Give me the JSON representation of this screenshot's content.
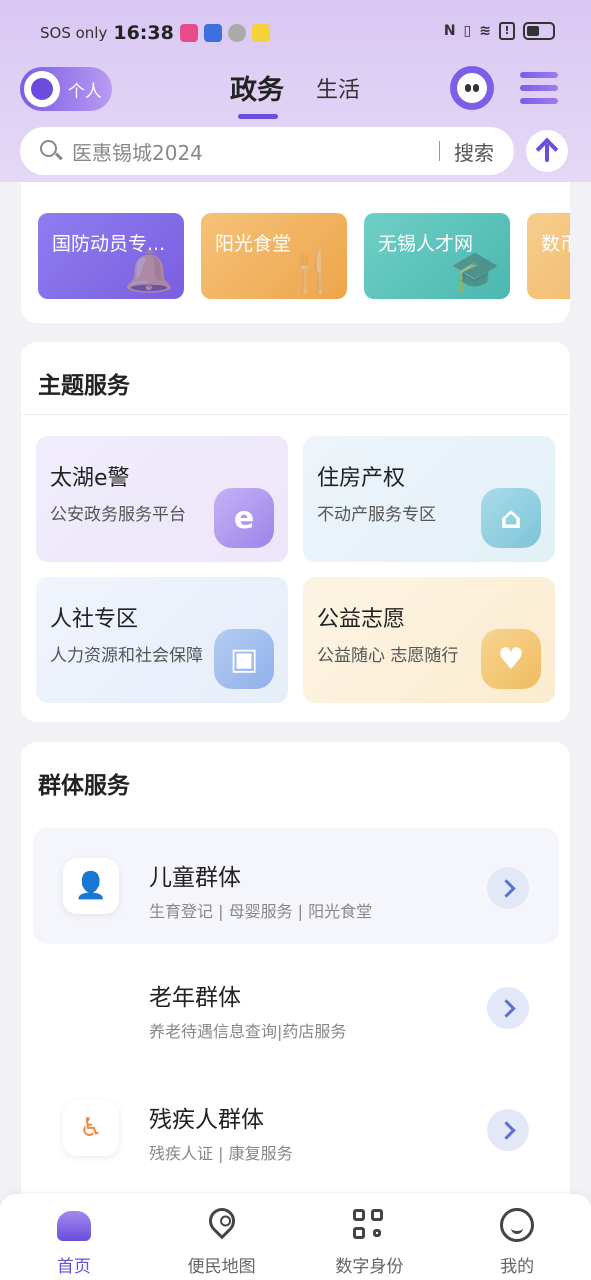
{
  "status_bar": {
    "carrier": "SOS only",
    "time": "16:38"
  },
  "header": {
    "personal_label": "个人",
    "tabs": [
      {
        "label": "政务",
        "active": true
      },
      {
        "label": "生活",
        "active": false
      }
    ],
    "accent_color": "#6a4ddc"
  },
  "search": {
    "placeholder": "医惠锡城2024",
    "button": "搜索"
  },
  "quick_links": [
    {
      "label": "国防动员专...",
      "color": "#8e74ea",
      "icon": "bell-icon"
    },
    {
      "label": "阳光食堂",
      "color": "#f0b460",
      "icon": "fork-knife-icon"
    },
    {
      "label": "无锡人才网",
      "color": "#5cc4bd",
      "icon": "graduation-cap-icon"
    },
    {
      "label": "数币",
      "color": "#f2c27c",
      "icon": "coin-icon"
    }
  ],
  "topic_services": {
    "title": "主题服务",
    "items": [
      {
        "title": "太湖e警",
        "subtitle": "公安政务服务平台",
        "icon": "police-shield-icon",
        "icon_glyph": "e"
      },
      {
        "title": "住房产权",
        "subtitle": "不动产服务专区",
        "icon": "house-icon",
        "icon_glyph": "⌂"
      },
      {
        "title": "人社专区",
        "subtitle": "人力资源和社会保障",
        "icon": "id-card-icon",
        "icon_glyph": "▣"
      },
      {
        "title": "公益志愿",
        "subtitle": "公益随心 志愿随行",
        "icon": "heart-hand-icon",
        "icon_glyph": "♥"
      }
    ]
  },
  "group_services": {
    "title": "群体服务",
    "items": [
      {
        "name": "儿童群体",
        "desc": "生育登记 | 母婴服务 | 阳光食堂",
        "icon": "child-icon"
      },
      {
        "name": "老年群体",
        "desc": "养老待遇信息查询|药店服务",
        "icon": "elderly-icon"
      },
      {
        "name": "残疾人群体",
        "desc": "残疾人证 | 康复服务",
        "icon": "wheelchair-icon"
      }
    ]
  },
  "bottom_nav": [
    {
      "label": "首页",
      "icon": "home-icon",
      "active": true
    },
    {
      "label": "便民地图",
      "icon": "map-pin-icon",
      "active": false
    },
    {
      "label": "数字身份",
      "icon": "qr-code-icon",
      "active": false
    },
    {
      "label": "我的",
      "icon": "smile-icon",
      "active": false
    }
  ]
}
